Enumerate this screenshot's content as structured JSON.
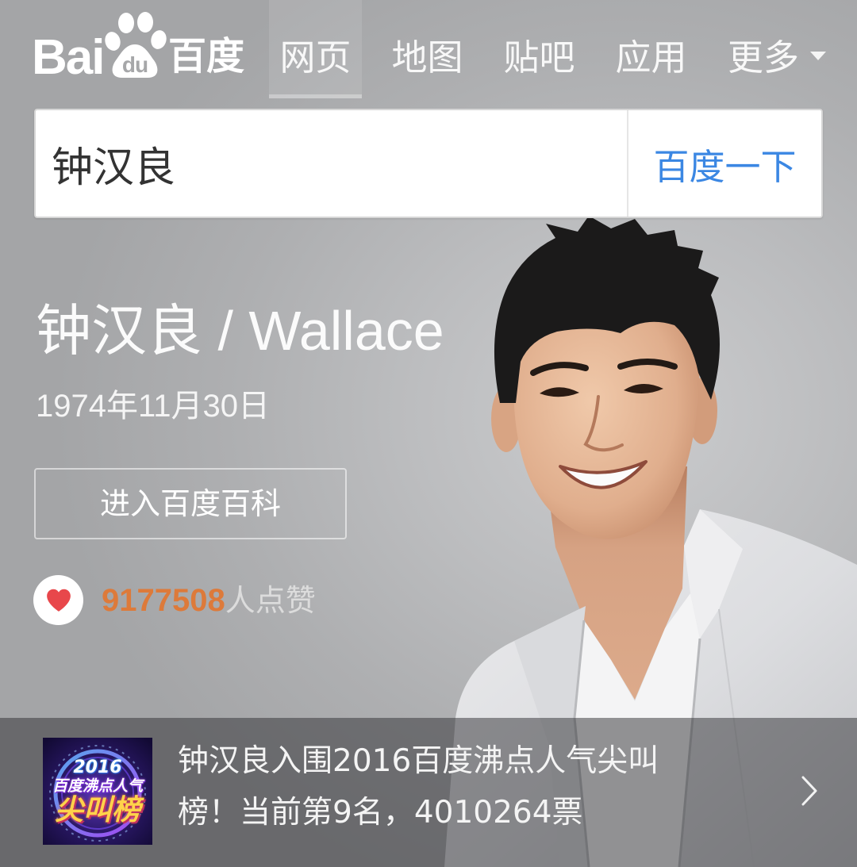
{
  "header": {
    "logo": {
      "text_left": "Bai",
      "text_pad": "du",
      "text_right": "百度",
      "icon": "paw-icon"
    },
    "tabs": [
      {
        "label": "网页",
        "active": true
      },
      {
        "label": "地图",
        "active": false
      },
      {
        "label": "贴吧",
        "active": false
      },
      {
        "label": "应用",
        "active": false
      },
      {
        "label": "更多",
        "active": false,
        "icon": "caret-down-icon"
      }
    ]
  },
  "search": {
    "value": "钟汉良",
    "button_label": "百度一下"
  },
  "profile": {
    "name": "钟汉良 / Wallace",
    "birthdate": "1974年11月30日",
    "baike_button_label": "进入百度百科",
    "likes": {
      "icon": "heart-icon",
      "count": "9177508",
      "suffix": "人点赞"
    }
  },
  "banner": {
    "thumbnail": {
      "year": "2016",
      "subtitle": "百度沸点人气",
      "title": "尖叫榜"
    },
    "lines": [
      "钟汉良入围2016百度沸点人气尖叫",
      "榜！当前第9名，4010264票"
    ],
    "icon": "chevron-right-icon"
  },
  "colors": {
    "header_bg": "#a6a7a9",
    "search_button_text": "#3b87e3",
    "like_count": "#dd7a3a",
    "heart": "#e8474b",
    "banner_thumb_title": "#ffd34a"
  }
}
